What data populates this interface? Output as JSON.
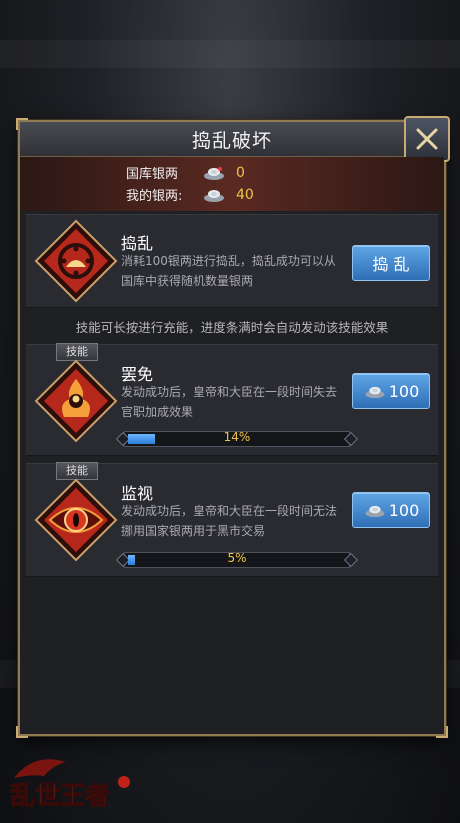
{
  "dialog": {
    "title": "捣乱破坏",
    "treasury_label": "国库银两",
    "treasury_value": "0",
    "my_silver_label": "我的银两:",
    "my_silver_value": "40",
    "tip": "技能可长按进行充能，进度条满时会自动发动该技能效果"
  },
  "disrupt": {
    "name": "捣乱",
    "desc": "消耗100银两进行捣乱，捣乱成功可以从国库中获得随机数量银两",
    "button_label": "捣 乱"
  },
  "skills": [
    {
      "tag": "技能",
      "name": "罢免",
      "desc": "发动成功后，皇帝和大臣在一段时间失去官职加成效果",
      "cost": "100",
      "progress_label": "14%",
      "progress": 0.14
    },
    {
      "tag": "技能",
      "name": "监视",
      "desc": "发动成功后，皇帝和大臣在一段时间无法挪用国家银两用于黑市交易",
      "cost": "100",
      "progress_label": "5%",
      "progress": 0.05
    }
  ],
  "logo": {
    "text": "乱世王者"
  },
  "colors": {
    "accent_gold": "#c8ab72",
    "button_blue": "#3f86cf",
    "value_yellow": "#f2c44a",
    "emblem_red": "#b6281c"
  },
  "icons": [
    "close-icon",
    "silver-ingot-icon",
    "disrupt-emblem-icon",
    "dismiss-emblem-icon",
    "surveil-emblem-icon"
  ]
}
